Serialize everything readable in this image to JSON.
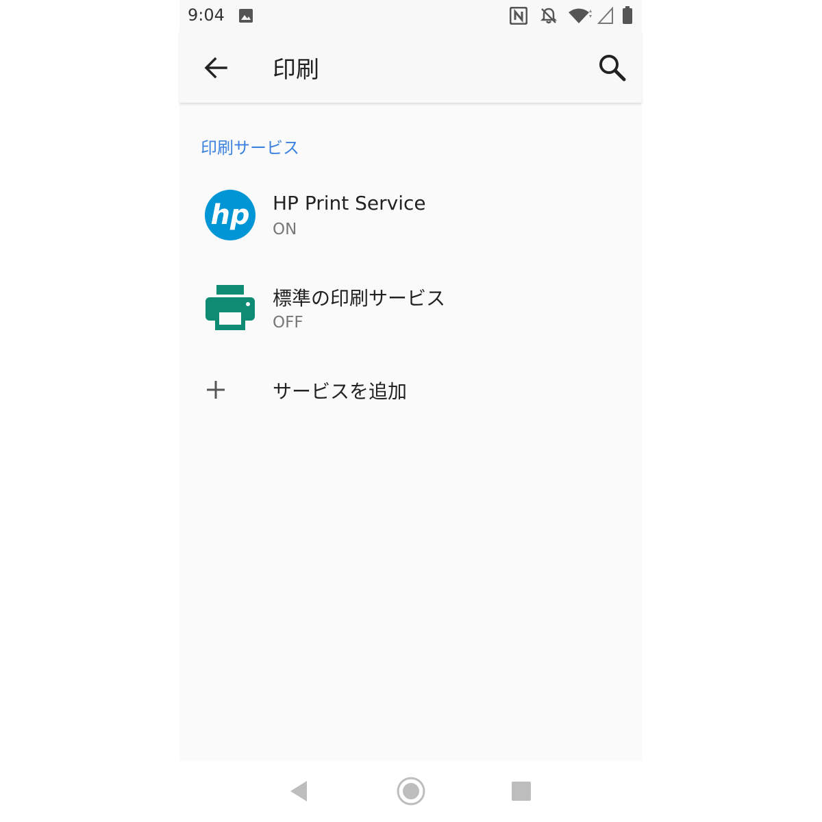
{
  "status_bar": {
    "time": "9:04",
    "icons": [
      "image-icon",
      "nfc-icon",
      "bell-off-icon",
      "wifi-icon",
      "signal-icon",
      "battery-icon"
    ]
  },
  "app_bar": {
    "title": "印刷",
    "back_icon": "arrow-left-icon",
    "search_icon": "search-icon"
  },
  "section": {
    "header": "印刷サービス"
  },
  "services": [
    {
      "name": "HP Print Service",
      "status": "ON",
      "icon": "hp-logo-icon"
    },
    {
      "name": "標準の印刷サービス",
      "status": "OFF",
      "icon": "printer-icon"
    }
  ],
  "add_service": {
    "label": "サービスを追加",
    "icon": "plus-icon"
  },
  "colors": {
    "accent": "#3b82e0",
    "hp_blue": "#0096d6",
    "printer_teal": "#0f8a73"
  },
  "nav_bar": {
    "icons": [
      "back-triangle-icon",
      "home-circle-icon",
      "recents-square-icon"
    ]
  }
}
